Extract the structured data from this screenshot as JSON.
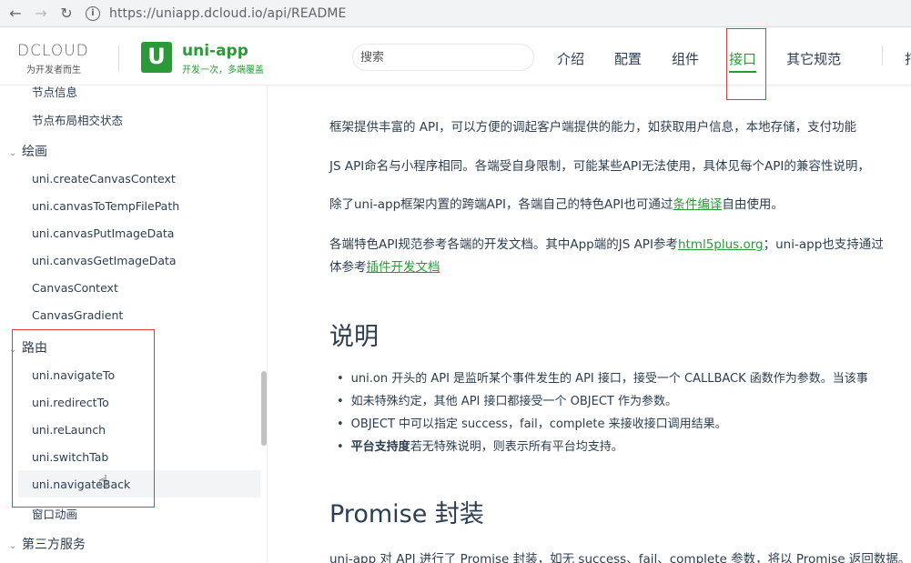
{
  "browser": {
    "url": "https://uniapp.dcloud.io/api/README"
  },
  "header": {
    "dcloud_logo": "DCLOUD",
    "dcloud_tagline": "为开发者而生",
    "brand_title": "uni-app",
    "brand_subtitle": "开发一次，多端覆盖",
    "search_placeholder": "搜索",
    "nav": [
      "介绍",
      "配置",
      "组件",
      "接口",
      "其它规范"
    ],
    "nav_cut": "打",
    "active_nav": "接口"
  },
  "sidebar": {
    "items": [
      {
        "type": "item",
        "label": "节点信息"
      },
      {
        "type": "item",
        "label": "节点布局相交状态"
      },
      {
        "type": "group",
        "label": "绘画"
      },
      {
        "type": "item",
        "label": "uni.createCanvasContext"
      },
      {
        "type": "item",
        "label": "uni.canvasToTempFilePath"
      },
      {
        "type": "item",
        "label": "uni.canvasPutImageData"
      },
      {
        "type": "item",
        "label": "uni.canvasGetImageData"
      },
      {
        "type": "item",
        "label": "CanvasContext"
      },
      {
        "type": "item",
        "label": "CanvasGradient"
      },
      {
        "type": "group",
        "label": "路由"
      },
      {
        "type": "item",
        "label": "uni.navigateTo"
      },
      {
        "type": "item",
        "label": "uni.redirectTo"
      },
      {
        "type": "item",
        "label": "uni.reLaunch"
      },
      {
        "type": "item",
        "label": "uni.switchTab"
      },
      {
        "type": "item",
        "label": "uni.navigateBack"
      },
      {
        "type": "item",
        "label": "窗口动画"
      },
      {
        "type": "group",
        "label": "第三方服务"
      }
    ]
  },
  "content": {
    "para1": "框架提供丰富的 API，可以方便的调起客户端提供的能力，如获取用户信息，本地存储，支付功能",
    "para2": "JS API命名与小程序相同。各端受自身限制，可能某些API无法使用，具体见每个API的兼容性说明，",
    "para3_pre": "除了uni-app框架内置的跨端API，各端自己的特色API也可通过",
    "para3_link": "条件编译",
    "para3_post": "自由使用。",
    "para4_pre": "各端特色API规范参考各端的开发文档。其中App端的JS API参考",
    "para4_link": "html5plus.org",
    "para4_post": "；uni-app也支持通过",
    "para4b_pre": "体参考",
    "para4b_link": "插件开发文档",
    "heading_1": "说明",
    "bullet1": "uni.on 开头的 API 是监听某个事件发生的 API 接口，接受一个 CALLBACK 函数作为参数。当该事",
    "bullet2": "如未特殊约定，其他 API 接口都接受一个 OBJECT 作为参数。",
    "bullet3": "OBJECT 中可以指定 success，fail，complete 来接收接口调用结果。",
    "bullet4_bold": "平台支持度",
    "bullet4_rest": "若无特殊说明，则表示所有平台均支持。",
    "heading_2": "Promise 封装",
    "para5": "uni-app 对 API 进行了 Promise 封装，如无 success、fail、complete 参数，将以 Promise 返回数据。"
  },
  "colors": {
    "brand_green": "#2b9939",
    "highlight_red": "#e53935",
    "dcloud_orange": "#e8731d"
  }
}
